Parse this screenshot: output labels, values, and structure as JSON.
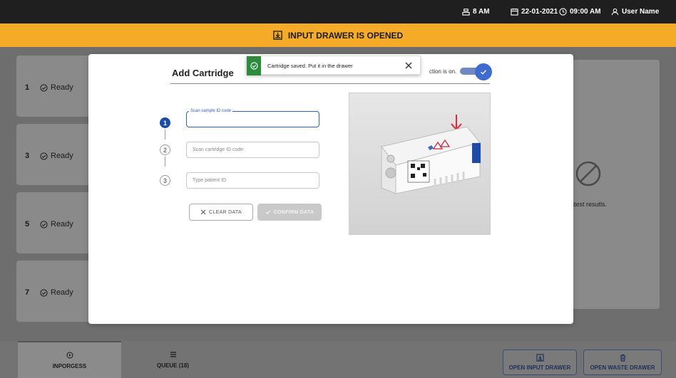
{
  "status_bar": {
    "drawer_status": "8 AM",
    "date": "22-01-2021",
    "time": "09:00 AM",
    "user": "User Name"
  },
  "banner": {
    "text": "INPUT DRAWER IS OPENED"
  },
  "slots": [
    {
      "number": "1",
      "status": "Ready"
    },
    {
      "number": "3",
      "status": "Ready"
    },
    {
      "number": "5",
      "status": "Ready"
    },
    {
      "number": "7",
      "status": "Ready"
    }
  ],
  "right_panel": {
    "text": "atest resutls."
  },
  "modal": {
    "title": "Add Cartridge",
    "title_suffix": "ction is on.",
    "toggle_on": true,
    "steps": [
      {
        "number": "1",
        "label": "Scan sample ID code",
        "value": ""
      },
      {
        "number": "2",
        "placeholder": "Scan cartridge ID code"
      },
      {
        "number": "3",
        "placeholder": "Type patient ID"
      }
    ],
    "clear_button": "CLEAR DATA",
    "confirm_button": "CONFIRM DATA"
  },
  "toast": {
    "message": "Cartridge saved. Put it in the drawer"
  },
  "bottom_bar": {
    "tabs": [
      {
        "label": "INPORGESS",
        "active": true
      },
      {
        "label": "QUEUE (18)",
        "active": false
      }
    ],
    "open_input_drawer": "OPEN INPUT DRAWER",
    "open_waste_drawer": "OPEN WASTE DRAWER"
  },
  "colors": {
    "banner": "#f5ab28",
    "accent": "#1e4aa8",
    "toast_success": "#2e8b3c",
    "arrow": "#e0283a"
  }
}
